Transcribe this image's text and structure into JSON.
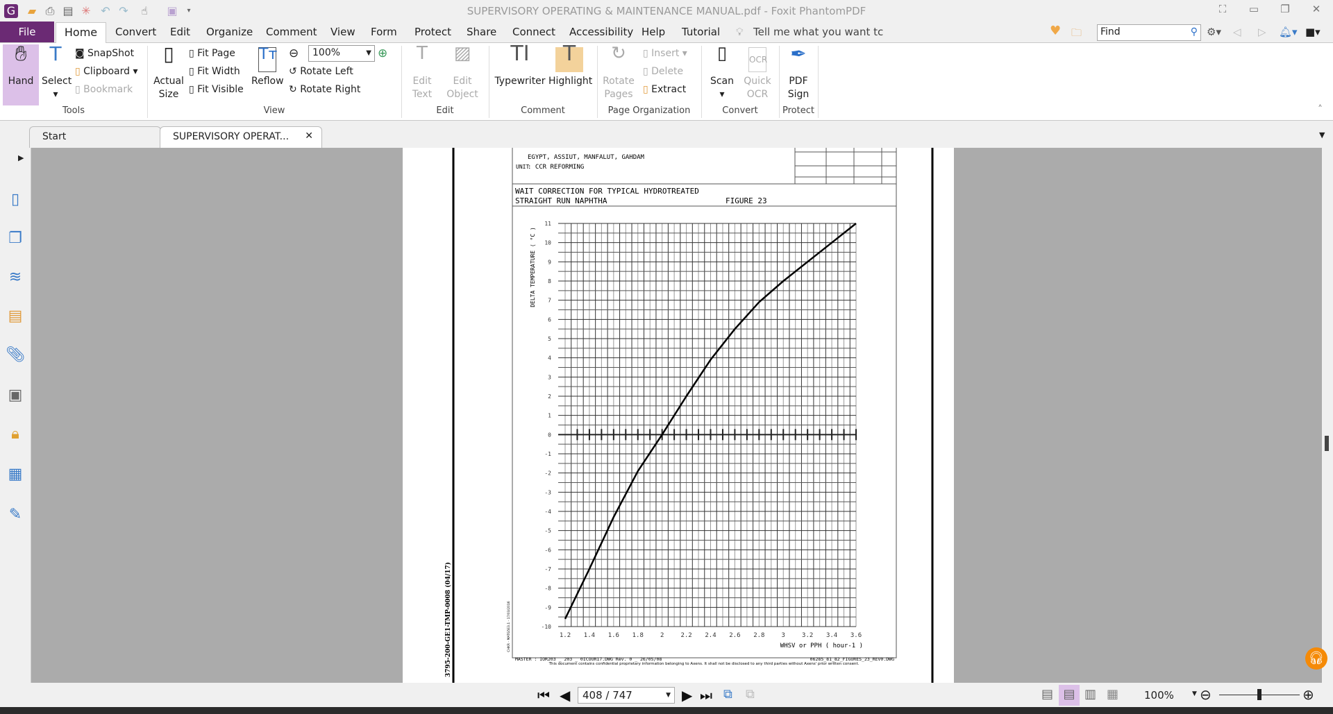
{
  "window": {
    "title": "SUPERVISORY OPERATING & MAINTENANCE MANUAL.pdf - Foxit PhantomPDF"
  },
  "menu": {
    "file": "File",
    "tabs": [
      "Home",
      "Convert",
      "Edit",
      "Organize",
      "Comment",
      "View",
      "Form",
      "Protect",
      "Share",
      "Connect",
      "Accessibility",
      "Help",
      "Tutorial"
    ],
    "tell_me": "Tell me what you want tc",
    "find_placeholder": "Find"
  },
  "ribbon": {
    "tools": {
      "label": "Tools",
      "hand": "Hand",
      "select": "Select",
      "snapshot": "SnapShot",
      "clipboard": "Clipboard",
      "bookmark": "Bookmark"
    },
    "view": {
      "label": "View",
      "actual_size": "Actual Size",
      "fit_page": "Fit Page",
      "fit_width": "Fit Width",
      "fit_visible": "Fit Visible",
      "reflow": "Reflow",
      "zoom": "100%",
      "rotate_left": "Rotate Left",
      "rotate_right": "Rotate Right"
    },
    "edit": {
      "label": "Edit",
      "edit_text": "Edit Text",
      "edit_object": "Edit Object"
    },
    "comment": {
      "label": "Comment",
      "typewriter": "Typewriter",
      "highlight": "Highlight"
    },
    "page_org": {
      "label": "Page Organization",
      "rotate_pages": "Rotate Pages",
      "insert": "Insert",
      "delete": "Delete",
      "extract": "Extract"
    },
    "convert": {
      "label": "Convert",
      "scan": "Scan",
      "quick_ocr": "Quick OCR"
    },
    "protect": {
      "label": "Protect",
      "pdf_sign": "PDF Sign"
    }
  },
  "doc_tabs": [
    {
      "label": "Start"
    },
    {
      "label": "SUPERVISORY OPERAT..."
    }
  ],
  "pdf": {
    "header_line1": "EGYPT, ASSIUT, MANFALUT, GAHDAM",
    "header_unit_label": "UNIT",
    "header_unit": ": CCR REFORMING",
    "title_line1": "WAIT CORRECTION FOR TYPICAL HYDROTREATED",
    "title_line2": "STRAIGHT RUN NAPHTHA",
    "figure": "FIGURE 23",
    "footer_master": "MASTER : IOR203 _ 203 _ 0ICOUR17.DWG Rev. 0 _ 26/05/08",
    "footer_file": "06285_81_82_FIGURES_23_REV0.DWG",
    "footer_confidential": "This document contains confidential proprietary information belonging to Axens. It shall not be disclosed to any third parties without Axens' prior written consent.",
    "side_code": "3795-200-GE1-TMP-0008   (04/17)",
    "side_small": "CHKR - MATG5E3.1 - 17/03/2016"
  },
  "chart_data": {
    "type": "line",
    "xlabel": "WHSV or PPH ( hour-1 )",
    "ylabel": "DELTA TEMPERATURE ( °C )",
    "xlim": [
      1.2,
      3.6
    ],
    "ylim": [
      -10,
      11
    ],
    "xticks": [
      "1.2",
      "1.4",
      "1.6",
      "1.8",
      "2",
      "2.2",
      "2.4",
      "2.6",
      "2.8",
      "3",
      "3.2",
      "3.4",
      "3.6"
    ],
    "yticks": [
      "11",
      "10",
      "9",
      "8",
      "7",
      "6",
      "5",
      "4",
      "3",
      "2",
      "1",
      "0",
      "-1",
      "-2",
      "-3",
      "-4",
      "-5",
      "-6",
      "-7",
      "-8",
      "-9",
      "-10"
    ],
    "grid": true,
    "series": [
      {
        "x": [
          1.2,
          1.4,
          1.6,
          1.8,
          2.0,
          2.2,
          2.4,
          2.6,
          2.8,
          3.0,
          3.2,
          3.4,
          3.6
        ],
        "y": [
          -9.6,
          -7.0,
          -4.3,
          -1.9,
          0,
          2.0,
          3.9,
          5.5,
          6.9,
          8.0,
          9.0,
          10.0,
          11.0
        ]
      }
    ]
  },
  "status": {
    "page": "408 / 747",
    "zoom": "100%",
    "zoom_slider_percent": 50
  },
  "colors": {
    "file_tab": "#6b2a74",
    "active_tool": "#dcc0e8",
    "highlight": "#f3d29b",
    "canvas": "#ababab",
    "help": "#f58a07"
  }
}
